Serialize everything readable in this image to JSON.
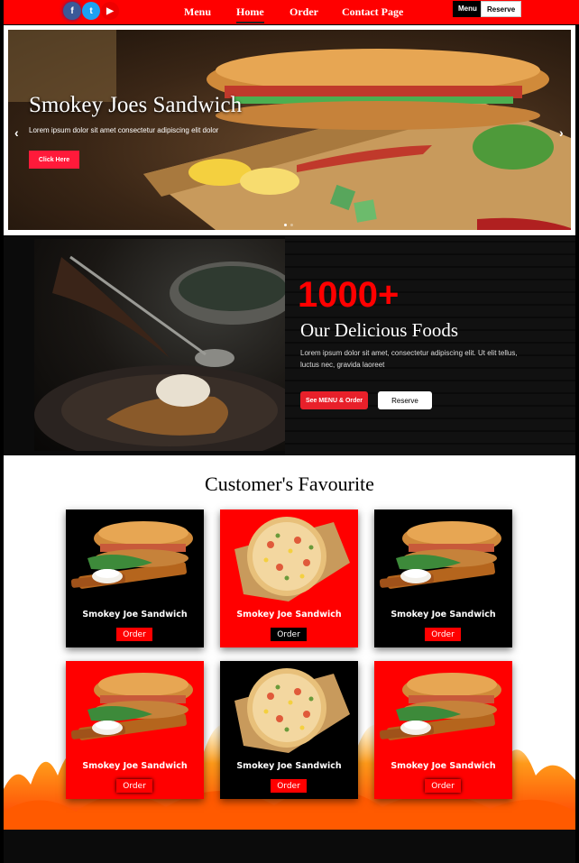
{
  "nav": {
    "social": [
      {
        "icon": "facebook-icon",
        "glyph": "f"
      },
      {
        "icon": "twitter-icon",
        "glyph": "t"
      },
      {
        "icon": "youtube-icon",
        "glyph": "▶"
      }
    ],
    "links": [
      "Menu",
      "Home",
      "Order",
      "Contact Page"
    ],
    "active": "Home",
    "menu_button": "Menu",
    "reserve_button": "Reserve"
  },
  "hero": {
    "title": "Smokey Joes Sandwich",
    "subtitle": "Lorem ipsum dolor sit amet consectetur adipiscing elit dolor",
    "button": "Click Here",
    "prev": "‹",
    "next": "›"
  },
  "feature": {
    "number": "1000+",
    "title": "Our Delicious Foods",
    "text": "Lorem ipsum dolor sit amet, consectetur adipiscing elit. Ut elit tellus, luctus nec, gravida laoreet",
    "menu_button": "See MENU & Order",
    "reserve_button": "Reserve"
  },
  "favourites": {
    "title": "Customer's Favourite",
    "cards": [
      {
        "name": "Smokey Joe Sandwich",
        "button": "Order",
        "bg": "black",
        "food": "sandwich"
      },
      {
        "name": "Smokey Joe Sandwich",
        "button": "Order",
        "bg": "red",
        "food": "pizza"
      },
      {
        "name": "Smokey Joe Sandwich",
        "button": "Order",
        "bg": "black",
        "food": "sandwich"
      },
      {
        "name": "Smokey Joe Sandwich",
        "button": "Order",
        "bg": "red",
        "food": "sandwich"
      },
      {
        "name": "Smokey Joe Sandwich",
        "button": "Order",
        "bg": "black",
        "food": "pizza"
      },
      {
        "name": "Smokey Joe Sandwich",
        "button": "Order",
        "bg": "red",
        "food": "sandwich"
      }
    ]
  },
  "colors": {
    "accent": "#ff0000",
    "dark": "#000000"
  }
}
